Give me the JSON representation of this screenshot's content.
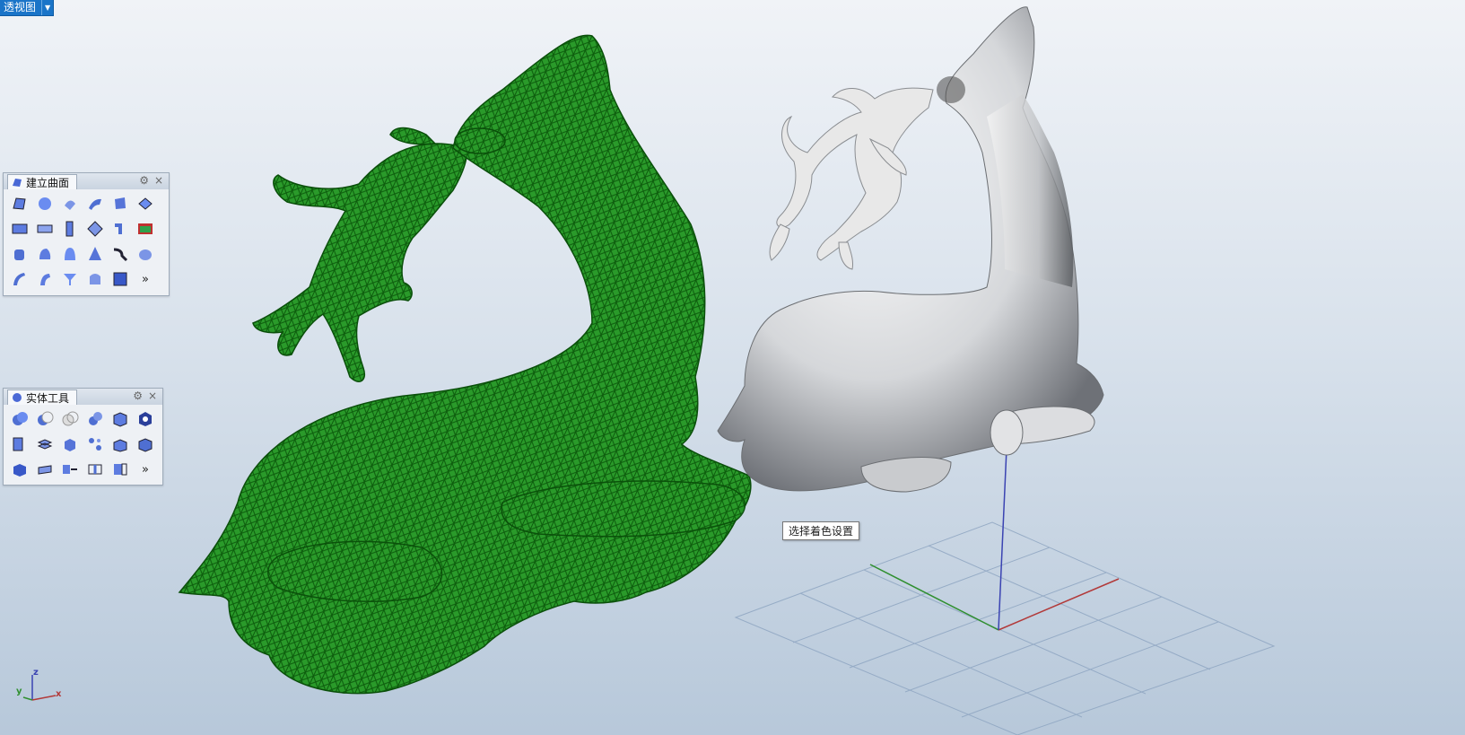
{
  "viewport": {
    "name": "透视图",
    "dropdown_icon": "triangle-down"
  },
  "panels": {
    "surface": {
      "title": "建立曲面",
      "gear_icon": "gear",
      "close_icon": "×",
      "more": "»"
    },
    "solid": {
      "title": "实体工具",
      "gear_icon": "gear",
      "close_icon": "×",
      "more": "»"
    }
  },
  "tooltip": "选择着色设置",
  "axes": {
    "z": "z",
    "y": "y",
    "x": "x"
  },
  "colors": {
    "mesh": "#1f8c1f",
    "axis_x": "#b23a3a",
    "axis_y": "#2f8f2f",
    "axis_z": "#3a43b2",
    "tab": "#1a74c8"
  }
}
